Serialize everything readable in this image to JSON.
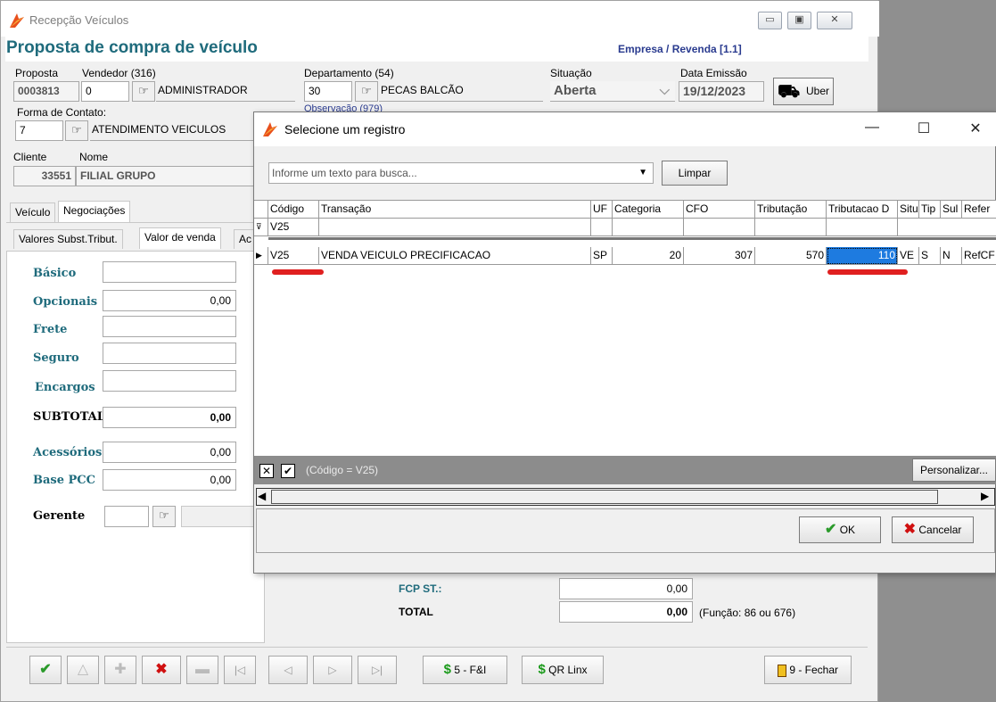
{
  "main_window": {
    "title": "Recepção Veículos",
    "page_title": "Proposta de compra de veículo",
    "empresa": "Empresa / Revenda [1.1]",
    "proposta": {
      "label": "Proposta",
      "value": "0003813"
    },
    "vendedor": {
      "label": "Vendedor (316)",
      "code": "0",
      "name": "ADMINISTRADOR"
    },
    "departamento": {
      "label": "Departamento (54)",
      "code": "30",
      "name": "PECAS BALCÃO"
    },
    "observacao_label": "Observação (979)",
    "situacao": {
      "label": "Situação",
      "value": "Aberta"
    },
    "data_emissao": {
      "label": "Data Emissão",
      "value": "19/12/2023"
    },
    "uber_button": "Uber",
    "forma_contato": {
      "label": "Forma de Contato:",
      "code": "7",
      "name": "ATENDIMENTO VEICULOS"
    },
    "cliente": {
      "label": "Cliente",
      "nome_label": "Nome",
      "code": "33551",
      "name": "FILIAL GRUPO"
    },
    "tabs": [
      "Veículo",
      "Negociações"
    ],
    "subtabs": [
      "Valores Subst.Tribut.",
      "Valor de venda",
      "Ac"
    ],
    "values": {
      "basico": {
        "label": "Básico",
        "value": ""
      },
      "opcionais": {
        "label": "Opcionais",
        "value": "0,00"
      },
      "frete": {
        "label": "Frete",
        "value": ""
      },
      "seguro": {
        "label": "Seguro",
        "value": ""
      },
      "encargos": {
        "label": "Encargos",
        "value": ""
      },
      "subtotal": {
        "label": "SUBTOTAL",
        "value": "0,00"
      },
      "acessorios": {
        "label": "Acessórios",
        "value": "0,00"
      },
      "base_pcc": {
        "label": "Base PCC",
        "value": "0,00"
      },
      "gerente": {
        "label": "Gerente",
        "value": ""
      }
    },
    "fcp_st": {
      "label": "FCP ST.:",
      "value": "0,00"
    },
    "total": {
      "label": "TOTAL",
      "value": "0,00",
      "note": "(Função: 86 ou 676)"
    },
    "toolbar": {
      "fi": "5 - F&I",
      "qr": "QR Linx",
      "fechar": "9 - Fechar"
    }
  },
  "dialog": {
    "title": "Selecione um registro",
    "search_placeholder": "Informe um texto para busca...",
    "limpar": "Limpar",
    "columns": [
      "Código",
      "Transação",
      "UF",
      "Categoria",
      "CFO",
      "Tributação",
      "Tributacao D",
      "Situ",
      "Tip",
      "Sul",
      "Refer"
    ],
    "filter_value": "V25",
    "row": {
      "codigo": "V25",
      "transacao": "VENDA VEICULO PRECIFICACAO",
      "uf": "SP",
      "categoria": "20",
      "cfo": "307",
      "tributacao": "570",
      "tributacao_d": "110",
      "situ": "VE",
      "tip": "S",
      "sul": "N",
      "refer": "RefCF"
    },
    "filter_text": "(Código = V25)",
    "personalizar": "Personalizar...",
    "ok": "OK",
    "cancelar": "Cancelar"
  },
  "colors": {
    "title_teal": "#1f6b7c",
    "empresa_blue": "#2a3b8f",
    "highlight": "#1e7be0",
    "annotation_red": "#e02020"
  }
}
